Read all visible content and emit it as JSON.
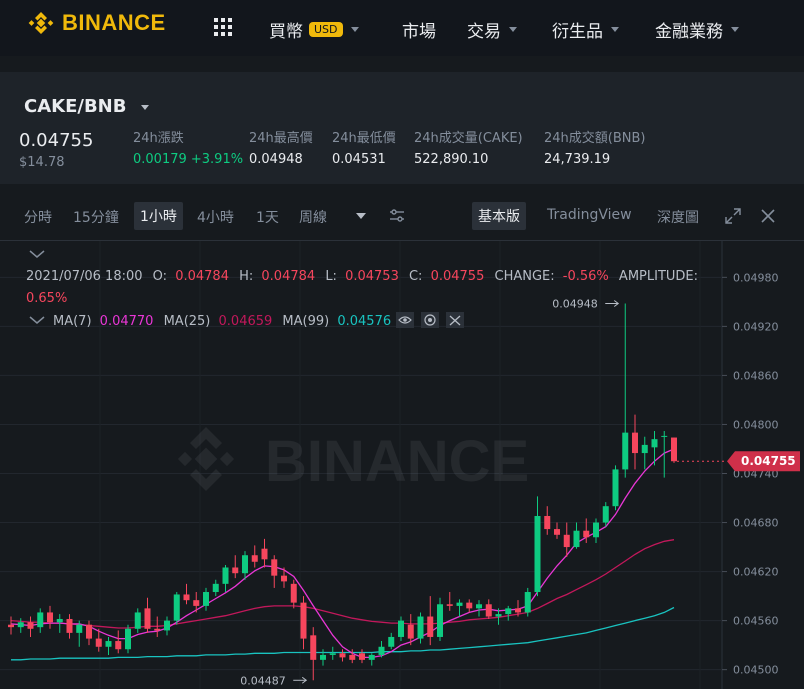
{
  "brand": {
    "name": "BINANCE"
  },
  "nav": {
    "buy": "買幣",
    "usd": "USD",
    "markets": "市場",
    "trade": "交易",
    "derivatives": "衍生品",
    "finance": "金融業務"
  },
  "market": {
    "pair": "CAKE/BNB",
    "last_price": "0.04755",
    "usd_price": "$14.78",
    "stats": [
      {
        "label": "24h漲跌",
        "value": "0.00179 +3.91%"
      },
      {
        "label": "24h最高價",
        "value": "0.04948"
      },
      {
        "label": "24h最低價",
        "value": "0.04531"
      },
      {
        "label": "24h成交量(CAKE)",
        "value": "522,890.10"
      },
      {
        "label": "24h成交額(BNB)",
        "value": "24,739.19"
      }
    ]
  },
  "toolbar": {
    "intervals": [
      "分時",
      "15分鐘",
      "1小時",
      "4小時",
      "1天",
      "周線"
    ],
    "active_interval": "1小時",
    "views": [
      "基本版",
      "TradingView",
      "深度圖"
    ],
    "active_view": "基本版"
  },
  "colors": {
    "up": "#0ecb81",
    "down": "#f6465d",
    "ma7": "#e936d6",
    "ma25": "#c2185b",
    "ma99": "#19c3c0",
    "accent": "#f0b90b"
  },
  "chart_data": {
    "type": "candlestick",
    "ohlc_header": {
      "datetime": "2021/07/06 18:00",
      "o": "0.04784",
      "h": "0.04784",
      "l": "0.04753",
      "c": "0.04755",
      "change": "-0.56%",
      "amplitude": "0.65%"
    },
    "ma": [
      {
        "name": "MA(7)",
        "value": "0.04770"
      },
      {
        "name": "MA(25)",
        "value": "0.04659"
      },
      {
        "name": "MA(99)",
        "value": "0.04576"
      }
    ],
    "y_ticks": [
      0.045,
      0.0456,
      0.0462,
      0.0468,
      0.0474,
      0.048,
      0.0486,
      0.0492,
      0.0498
    ],
    "ylim": [
      0.0448,
      0.05
    ],
    "current_price": "0.04755",
    "annotations": [
      {
        "label": "0.04948",
        "value": 0.04948
      },
      {
        "label": "0.04487",
        "value": 0.04487
      }
    ],
    "candles": [
      {
        "o": 0.04555,
        "h": 0.04565,
        "l": 0.04543,
        "c": 0.04552
      },
      {
        "o": 0.04552,
        "h": 0.04563,
        "l": 0.04545,
        "c": 0.04558
      },
      {
        "o": 0.04558,
        "h": 0.04565,
        "l": 0.0454,
        "c": 0.0455
      },
      {
        "o": 0.04552,
        "h": 0.04575,
        "l": 0.04545,
        "c": 0.0457
      },
      {
        "o": 0.0457,
        "h": 0.04578,
        "l": 0.0455,
        "c": 0.04558
      },
      {
        "o": 0.04558,
        "h": 0.04568,
        "l": 0.04545,
        "c": 0.04562
      },
      {
        "o": 0.04562,
        "h": 0.04568,
        "l": 0.04538,
        "c": 0.04545
      },
      {
        "o": 0.04545,
        "h": 0.0456,
        "l": 0.04528,
        "c": 0.04555
      },
      {
        "o": 0.04555,
        "h": 0.0456,
        "l": 0.0453,
        "c": 0.04538
      },
      {
        "o": 0.04538,
        "h": 0.0455,
        "l": 0.04522,
        "c": 0.04528
      },
      {
        "o": 0.04528,
        "h": 0.0454,
        "l": 0.04518,
        "c": 0.04535
      },
      {
        "o": 0.04535,
        "h": 0.04548,
        "l": 0.0452,
        "c": 0.04525
      },
      {
        "o": 0.04525,
        "h": 0.04555,
        "l": 0.0452,
        "c": 0.0455
      },
      {
        "o": 0.0455,
        "h": 0.04575,
        "l": 0.04545,
        "c": 0.0457
      },
      {
        "o": 0.04575,
        "h": 0.04588,
        "l": 0.04545,
        "c": 0.0455
      },
      {
        "o": 0.0455,
        "h": 0.04565,
        "l": 0.0454,
        "c": 0.04548
      },
      {
        "o": 0.04548,
        "h": 0.04565,
        "l": 0.04542,
        "c": 0.0456
      },
      {
        "o": 0.0456,
        "h": 0.04595,
        "l": 0.04555,
        "c": 0.04592
      },
      {
        "o": 0.04592,
        "h": 0.04605,
        "l": 0.0458,
        "c": 0.04585
      },
      {
        "o": 0.04585,
        "h": 0.04595,
        "l": 0.0457,
        "c": 0.04578
      },
      {
        "o": 0.04578,
        "h": 0.046,
        "l": 0.04572,
        "c": 0.04595
      },
      {
        "o": 0.04595,
        "h": 0.0461,
        "l": 0.0459,
        "c": 0.04605
      },
      {
        "o": 0.04605,
        "h": 0.04628,
        "l": 0.04595,
        "c": 0.04625
      },
      {
        "o": 0.04625,
        "h": 0.0464,
        "l": 0.04612,
        "c": 0.04618
      },
      {
        "o": 0.04618,
        "h": 0.04645,
        "l": 0.0461,
        "c": 0.0464
      },
      {
        "o": 0.0464,
        "h": 0.04652,
        "l": 0.04625,
        "c": 0.04632
      },
      {
        "o": 0.04648,
        "h": 0.0466,
        "l": 0.04625,
        "c": 0.04635
      },
      {
        "o": 0.04635,
        "h": 0.0464,
        "l": 0.046,
        "c": 0.04615
      },
      {
        "o": 0.04615,
        "h": 0.04625,
        "l": 0.046,
        "c": 0.04608
      },
      {
        "o": 0.04605,
        "h": 0.0461,
        "l": 0.04575,
        "c": 0.04582
      },
      {
        "o": 0.04582,
        "h": 0.0459,
        "l": 0.04525,
        "c": 0.04538
      },
      {
        "o": 0.04542,
        "h": 0.04552,
        "l": 0.04487,
        "c": 0.04512
      },
      {
        "o": 0.04512,
        "h": 0.04525,
        "l": 0.04505,
        "c": 0.04518
      },
      {
        "o": 0.04518,
        "h": 0.04528,
        "l": 0.04512,
        "c": 0.0452
      },
      {
        "o": 0.0452,
        "h": 0.04525,
        "l": 0.0451,
        "c": 0.04515
      },
      {
        "o": 0.04518,
        "h": 0.04525,
        "l": 0.04508,
        "c": 0.04512
      },
      {
        "o": 0.0452,
        "h": 0.04525,
        "l": 0.04508,
        "c": 0.04512
      },
      {
        "o": 0.04512,
        "h": 0.0452,
        "l": 0.04505,
        "c": 0.04518
      },
      {
        "o": 0.04518,
        "h": 0.04535,
        "l": 0.04515,
        "c": 0.04528
      },
      {
        "o": 0.04528,
        "h": 0.04545,
        "l": 0.04525,
        "c": 0.0454
      },
      {
        "o": 0.0454,
        "h": 0.04565,
        "l": 0.04535,
        "c": 0.0456
      },
      {
        "o": 0.04555,
        "h": 0.04568,
        "l": 0.0453,
        "c": 0.04538
      },
      {
        "o": 0.04538,
        "h": 0.0457,
        "l": 0.04532,
        "c": 0.04565
      },
      {
        "o": 0.04565,
        "h": 0.0459,
        "l": 0.0453,
        "c": 0.0454
      },
      {
        "o": 0.0454,
        "h": 0.04588,
        "l": 0.04535,
        "c": 0.0458
      },
      {
        "o": 0.0458,
        "h": 0.04595,
        "l": 0.04572,
        "c": 0.04578
      },
      {
        "o": 0.04578,
        "h": 0.04586,
        "l": 0.04565,
        "c": 0.04582
      },
      {
        "o": 0.04582,
        "h": 0.04586,
        "l": 0.0457,
        "c": 0.04575
      },
      {
        "o": 0.04575,
        "h": 0.04585,
        "l": 0.04565,
        "c": 0.0458
      },
      {
        "o": 0.0458,
        "h": 0.04586,
        "l": 0.04562,
        "c": 0.04565
      },
      {
        "o": 0.04565,
        "h": 0.04575,
        "l": 0.04555,
        "c": 0.04568
      },
      {
        "o": 0.04568,
        "h": 0.04578,
        "l": 0.0456,
        "c": 0.04575
      },
      {
        "o": 0.04575,
        "h": 0.04585,
        "l": 0.04565,
        "c": 0.0457
      },
      {
        "o": 0.0457,
        "h": 0.046,
        "l": 0.04565,
        "c": 0.04595
      },
      {
        "o": 0.04595,
        "h": 0.04712,
        "l": 0.0459,
        "c": 0.04688
      },
      {
        "o": 0.04688,
        "h": 0.047,
        "l": 0.04665,
        "c": 0.04672
      },
      {
        "o": 0.04672,
        "h": 0.0468,
        "l": 0.0466,
        "c": 0.04665
      },
      {
        "o": 0.04665,
        "h": 0.0468,
        "l": 0.04638,
        "c": 0.0465
      },
      {
        "o": 0.0465,
        "h": 0.0468,
        "l": 0.04648,
        "c": 0.0467
      },
      {
        "o": 0.0467,
        "h": 0.04685,
        "l": 0.04655,
        "c": 0.04662
      },
      {
        "o": 0.04662,
        "h": 0.04685,
        "l": 0.04655,
        "c": 0.0468
      },
      {
        "o": 0.0468,
        "h": 0.04705,
        "l": 0.04675,
        "c": 0.047
      },
      {
        "o": 0.047,
        "h": 0.0475,
        "l": 0.04695,
        "c": 0.04745
      },
      {
        "o": 0.04745,
        "h": 0.04948,
        "l": 0.04735,
        "c": 0.0479
      },
      {
        "o": 0.0479,
        "h": 0.04812,
        "l": 0.04745,
        "c": 0.04765
      },
      {
        "o": 0.04765,
        "h": 0.04785,
        "l": 0.04745,
        "c": 0.04775
      },
      {
        "o": 0.04772,
        "h": 0.04792,
        "l": 0.0475,
        "c": 0.04782
      },
      {
        "o": 0.04786,
        "h": 0.04792,
        "l": 0.04735,
        "c": 0.04786
      },
      {
        "o": 0.04784,
        "h": 0.04784,
        "l": 0.04753,
        "c": 0.04755
      }
    ],
    "ma7_line": [
      0.04556,
      0.04555,
      0.04554,
      0.04556,
      0.04557,
      0.04557,
      0.04556,
      0.04556,
      0.04553,
      0.04547,
      0.04542,
      0.04538,
      0.04538,
      0.04543,
      0.04546,
      0.04547,
      0.04551,
      0.04558,
      0.04566,
      0.04573,
      0.0458,
      0.04587,
      0.04594,
      0.04602,
      0.04612,
      0.04621,
      0.04627,
      0.04626,
      0.04622,
      0.04614,
      0.04597,
      0.04578,
      0.0456,
      0.04542,
      0.04528,
      0.0452,
      0.04515,
      0.04515,
      0.04517,
      0.04522,
      0.0453,
      0.04534,
      0.0454,
      0.04546,
      0.04554,
      0.0456,
      0.04565,
      0.0457,
      0.04573,
      0.04574,
      0.04572,
      0.04573,
      0.04574,
      0.04578,
      0.04595,
      0.04612,
      0.04627,
      0.0464,
      0.04655,
      0.04662,
      0.04668,
      0.04675,
      0.0469,
      0.0471,
      0.04728,
      0.04743,
      0.04755,
      0.04765,
      0.0477
    ],
    "ma25_line": [
      0.0456,
      0.04559,
      0.04558,
      0.04558,
      0.04557,
      0.04557,
      0.04556,
      0.04555,
      0.04554,
      0.04553,
      0.04552,
      0.04551,
      0.04551,
      0.04552,
      0.04553,
      0.04553,
      0.04554,
      0.04556,
      0.04558,
      0.0456,
      0.04562,
      0.04564,
      0.04566,
      0.04569,
      0.04572,
      0.04575,
      0.04577,
      0.04578,
      0.04578,
      0.04578,
      0.04577,
      0.04575,
      0.04572,
      0.04569,
      0.04566,
      0.04563,
      0.04561,
      0.04559,
      0.04558,
      0.04557,
      0.04557,
      0.04556,
      0.04556,
      0.04556,
      0.04557,
      0.04558,
      0.04559,
      0.04561,
      0.04562,
      0.04563,
      0.04564,
      0.04566,
      0.04568,
      0.0457,
      0.04575,
      0.04581,
      0.04587,
      0.04592,
      0.04598,
      0.04604,
      0.0461,
      0.04617,
      0.04625,
      0.04633,
      0.04641,
      0.04648,
      0.04653,
      0.04657,
      0.04659
    ],
    "ma99_line": [
      0.04512,
      0.04512,
      0.04513,
      0.04513,
      0.04513,
      0.04514,
      0.04514,
      0.04514,
      0.04514,
      0.04514,
      0.04514,
      0.04515,
      0.04515,
      0.04515,
      0.04516,
      0.04516,
      0.04516,
      0.04517,
      0.04517,
      0.04517,
      0.04518,
      0.04518,
      0.04518,
      0.04519,
      0.04519,
      0.0452,
      0.0452,
      0.0452,
      0.04521,
      0.04521,
      0.04521,
      0.04521,
      0.04521,
      0.04521,
      0.04521,
      0.04521,
      0.04521,
      0.04521,
      0.04522,
      0.04522,
      0.04522,
      0.04523,
      0.04523,
      0.04524,
      0.04524,
      0.04525,
      0.04526,
      0.04527,
      0.04528,
      0.04529,
      0.0453,
      0.04531,
      0.04532,
      0.04533,
      0.04535,
      0.04537,
      0.04539,
      0.04541,
      0.04543,
      0.04545,
      0.04548,
      0.04551,
      0.04554,
      0.04557,
      0.0456,
      0.04563,
      0.04566,
      0.0457,
      0.04576
    ]
  }
}
